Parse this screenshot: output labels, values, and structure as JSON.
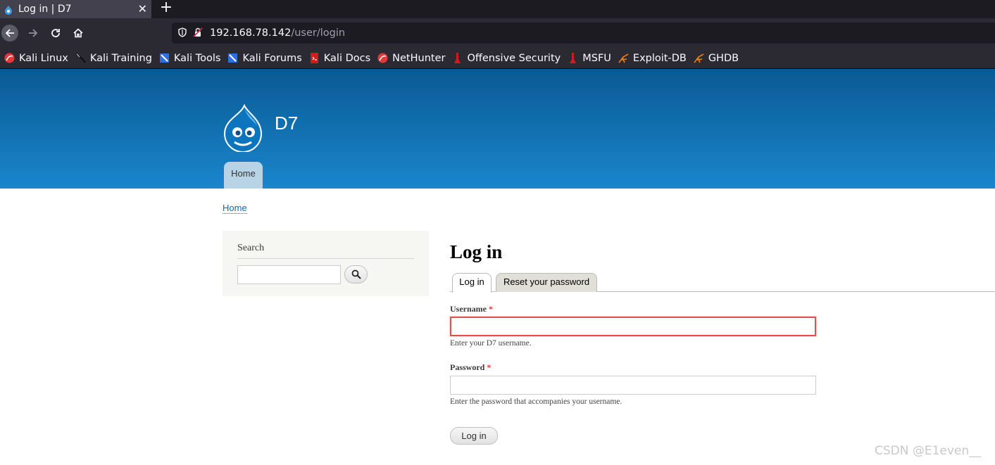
{
  "browser": {
    "tab_title": "Log in | D7",
    "tab_close": "✕",
    "new_tab": "+",
    "url_host": "192.168.78.142",
    "url_path": "/user/login",
    "bookmarks": [
      {
        "label": "Kali Linux",
        "icon": "kali-linux-icon"
      },
      {
        "label": "Kali Training",
        "icon": "kali-training-icon"
      },
      {
        "label": "Kali Tools",
        "icon": "kali-tools-icon"
      },
      {
        "label": "Kali Forums",
        "icon": "kali-forums-icon"
      },
      {
        "label": "Kali Docs",
        "icon": "kali-docs-icon"
      },
      {
        "label": "NetHunter",
        "icon": "nethunter-icon"
      },
      {
        "label": "Offensive Security",
        "icon": "offensive-security-icon"
      },
      {
        "label": "MSFU",
        "icon": "msfu-icon"
      },
      {
        "label": "Exploit-DB",
        "icon": "exploit-db-icon"
      },
      {
        "label": "GHDB",
        "icon": "ghdb-icon"
      }
    ]
  },
  "site": {
    "name": "D7",
    "main_menu_home": "Home",
    "breadcrumb": "Home",
    "header_color_top": "#0a5a94",
    "header_color_bottom": "#1a86cc"
  },
  "sidebar": {
    "search_title": "Search",
    "search_value": ""
  },
  "main": {
    "page_title": "Log in",
    "tabs": [
      {
        "label": "Log in",
        "active": true
      },
      {
        "label": "Reset your password",
        "active": false
      }
    ],
    "username": {
      "label": "Username",
      "required_mark": "*",
      "value": "",
      "description": "Enter your D7 username."
    },
    "password": {
      "label": "Password",
      "required_mark": "*",
      "value": "",
      "description": "Enter the password that accompanies your username."
    },
    "submit_label": "Log in"
  },
  "watermark": "CSDN @E1even__"
}
